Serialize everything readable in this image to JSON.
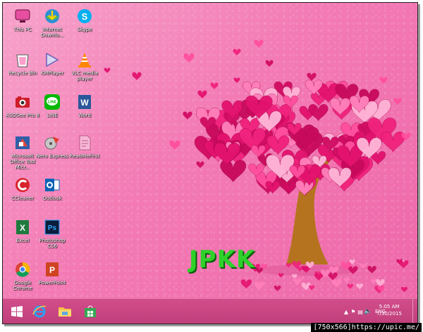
{
  "desktop": {
    "icons": [
      {
        "label": "This PC",
        "icon": "this-pc-icon"
      },
      {
        "label": "Internet Downlo...",
        "icon": "idm-icon"
      },
      {
        "label": "Skype",
        "icon": "skype-icon"
      },
      {
        "label": "Recycle Bin",
        "icon": "recycle-bin-icon"
      },
      {
        "label": "KMPlayer",
        "icon": "kmplayer-icon"
      },
      {
        "label": "VLC media player",
        "icon": "vlc-icon"
      },
      {
        "label": "ASDSee Pro 8",
        "icon": "acdsee-icon"
      },
      {
        "label": "LINE",
        "icon": "line-icon"
      },
      {
        "label": "Word",
        "icon": "word-icon"
      },
      {
        "label": "Microsoft Office Tool Micr...",
        "icon": "office-tools-icon"
      },
      {
        "label": "Nero Express",
        "icon": "nero-icon"
      },
      {
        "label": "ReadMeFirst",
        "icon": "readme-icon"
      },
      {
        "label": "CCleaner",
        "icon": "ccleaner-icon"
      },
      {
        "label": "Outlook",
        "icon": "outlook-icon"
      },
      {
        "label": "Excel",
        "icon": "excel-icon"
      },
      {
        "label": "Photoshop CS6",
        "icon": "photoshop-icon"
      },
      {
        "label": "Google Chrome",
        "icon": "chrome-icon"
      },
      {
        "label": "PowerPoint",
        "icon": "powerpoint-icon"
      }
    ],
    "wallpaper_text": "JPKK"
  },
  "taskbar": {
    "pinned": [
      "start-icon",
      "internet-explorer-icon",
      "file-explorer-icon",
      "store-icon"
    ],
    "tray": {
      "language": "ENG",
      "time": "5:05 AM",
      "date": "7/30/2015"
    }
  },
  "watermark": "[750x566]https://upic.me/",
  "colors": {
    "wallpaper": "#f37bb5",
    "taskbar": "#c9457f",
    "heart_dark": "#e3126f",
    "heart_light": "#ffb3d6",
    "trunk": "#b5731f",
    "logo_text": "#2fd12b"
  }
}
